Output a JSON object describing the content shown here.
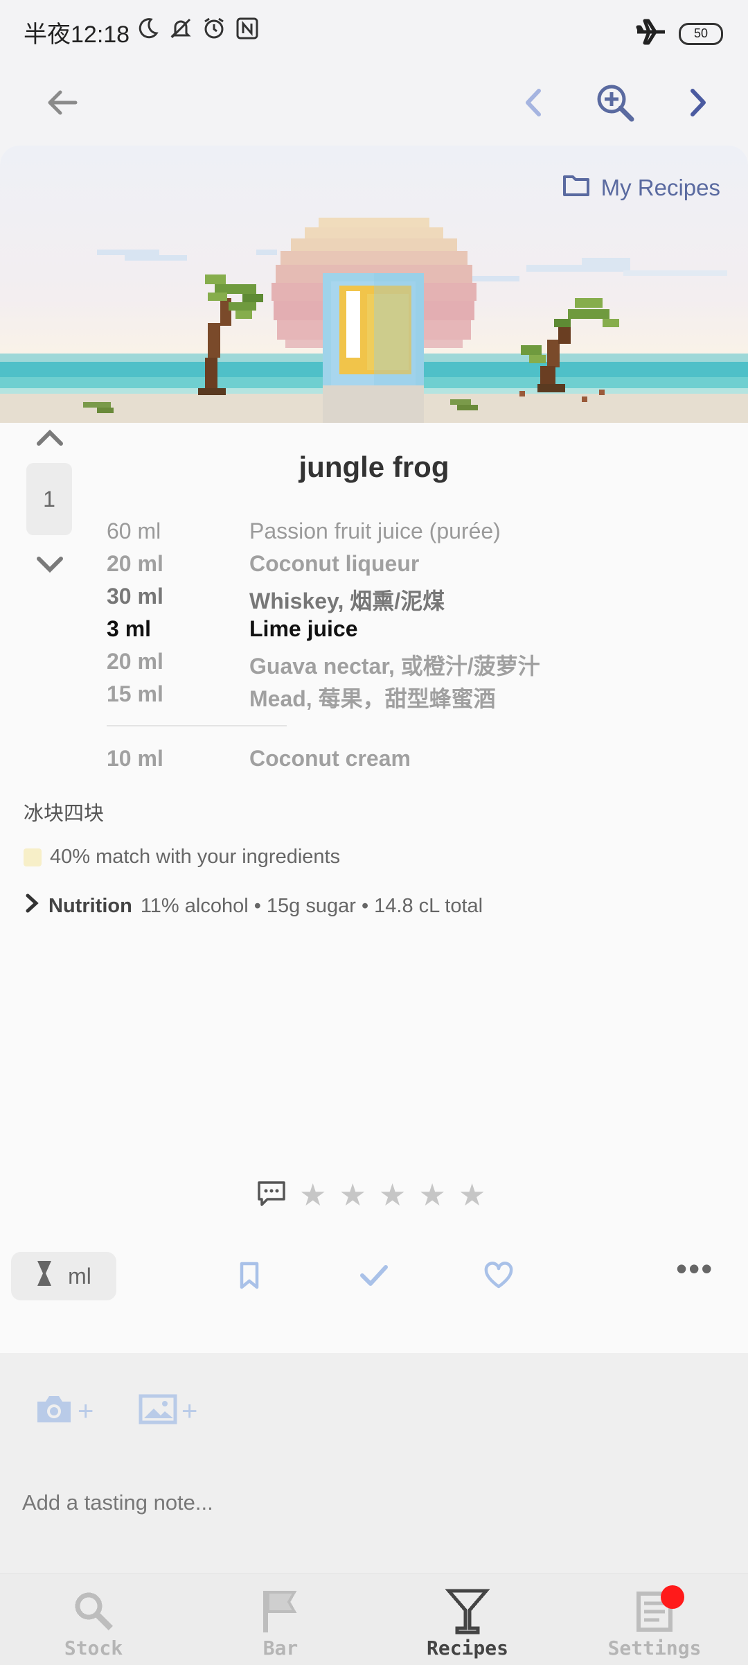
{
  "status_bar": {
    "time": "半夜12:18",
    "battery": "50",
    "icons": [
      "moon-icon",
      "bell-off-icon",
      "alarm-icon",
      "nfc-icon",
      "airplane-icon"
    ]
  },
  "nav": {
    "icons": [
      "arrow-left-icon",
      "chevron-left-icon",
      "zoom-in-icon",
      "chevron-right-icon"
    ]
  },
  "recipe": {
    "folder": "My Recipes",
    "title": "jungle frog",
    "servings": "1",
    "ingredients": [
      {
        "amount": "60 ml",
        "name": "Passion fruit juice (purée)"
      },
      {
        "amount": "20 ml",
        "name": "Coconut liqueur"
      },
      {
        "amount": "30 ml",
        "name": "Whiskey, 烟熏/泥煤"
      },
      {
        "amount": "3 ml",
        "name": "Lime juice"
      },
      {
        "amount": "20 ml",
        "name": "Guava nectar, 或橙汁/菠萝汁"
      },
      {
        "amount": "15 ml",
        "name": "Mead, 莓果，甜型蜂蜜酒"
      }
    ],
    "garnish": {
      "amount": "10 ml",
      "name": "Coconut cream"
    },
    "note": "冰块四块",
    "match": "40% match with your ingredients",
    "nutrition_label": "Nutrition",
    "nutrition_summary": "11% alcohol • 15g sugar • 14.8 cL total"
  },
  "rating": {
    "stars": 5,
    "value": 0
  },
  "actions": {
    "unit": "ml",
    "more": "•••"
  },
  "tasting": {
    "placeholder": "Add a tasting note..."
  },
  "tabs": [
    {
      "label": "Stock",
      "icon": "search-icon",
      "active": false
    },
    {
      "label": "Bar",
      "icon": "flag-icon",
      "active": false
    },
    {
      "label": "Recipes",
      "icon": "cocktail-glass-icon",
      "active": true
    },
    {
      "label": "Settings",
      "icon": "list-icon",
      "active": false
    }
  ],
  "colors": {
    "accent": "#5a6aa0",
    "action_blue": "#a9c1e8",
    "badge": "#ff1a1a",
    "background": "#fafafa"
  }
}
